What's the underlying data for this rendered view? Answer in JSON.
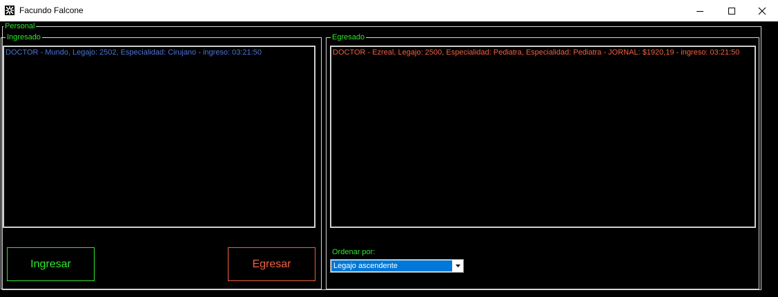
{
  "window": {
    "title": "Facundo Falcone",
    "icon": "app-icon"
  },
  "groups": {
    "personal": "Personal",
    "ingresado": "Ingresado",
    "egresado": "Egresado"
  },
  "lists": {
    "ingresado": [
      "DOCTOR - Mundo, Legajo: 2502, Especialidad: Cirujano - ingreso: 03:21:50"
    ],
    "egresado": [
      "DOCTOR - Ezreal, Legajo: 2500, Especialidad: Pediatra, Especialidad: Pediatra - JORNAL: $1920,19 - ingreso: 03:21:50"
    ]
  },
  "buttons": {
    "ingresar": "Ingresar",
    "egresar": "Egresar"
  },
  "order": {
    "label": "Ordenar por:",
    "selected": "Legajo ascendente"
  },
  "colors": {
    "accent_green": "#2ee82e",
    "item_blue": "#4a74d9",
    "accent_red": "#f2603e",
    "selection_blue": "#0078d7"
  }
}
